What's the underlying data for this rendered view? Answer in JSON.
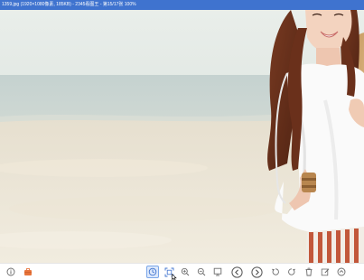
{
  "window": {
    "title": "1359.jpg (1920×1080像素, 185KB) - 2345看图王 - 第15/17张 100%",
    "accent_color": "#3f73cf"
  },
  "image": {
    "subject": "photo-beach-woman"
  },
  "toolbar": {
    "buttons": [
      {
        "icon": "info-icon"
      },
      {
        "icon": "briefcase-icon"
      },
      {
        "icon": "actual-size-icon",
        "active": true
      },
      {
        "icon": "fit-window-icon"
      },
      {
        "icon": "zoom-in-icon"
      },
      {
        "icon": "zoom-out-icon"
      },
      {
        "icon": "slideshow-icon"
      },
      {
        "icon": "previous-icon"
      },
      {
        "icon": "next-icon"
      },
      {
        "icon": "rotate-left-icon"
      },
      {
        "icon": "rotate-right-icon"
      },
      {
        "icon": "delete-icon"
      },
      {
        "icon": "edit-icon"
      },
      {
        "icon": "more-icon"
      }
    ]
  }
}
